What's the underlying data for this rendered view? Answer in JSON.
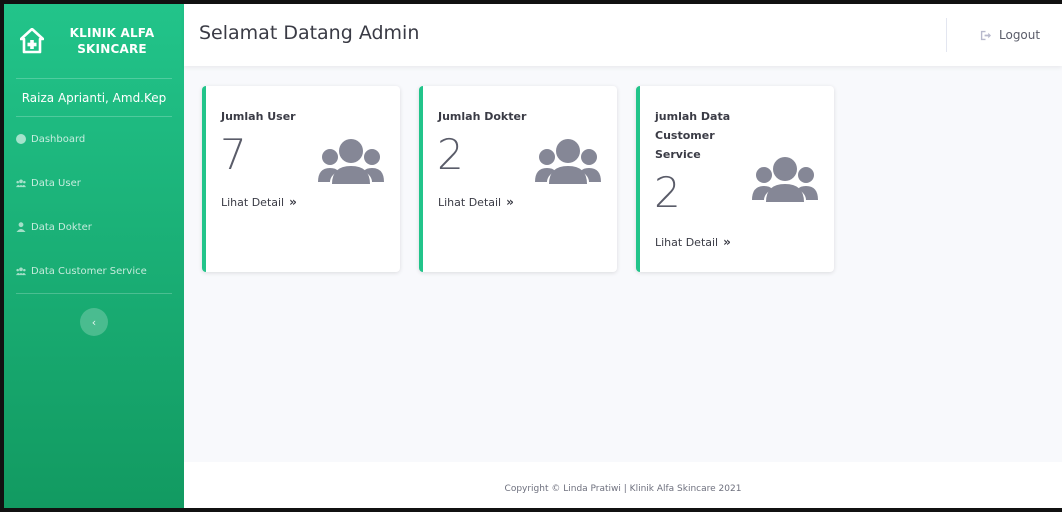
{
  "brand": {
    "line1": "KLINIK ALFA",
    "line2": "SKINCARE"
  },
  "sidebar": {
    "user_name": "Raiza Aprianti, Amd.Kep",
    "items": [
      {
        "label": "Dashboard",
        "icon": "palette-icon"
      },
      {
        "label": "Data User",
        "icon": "users-icon"
      },
      {
        "label": "Data Dokter",
        "icon": "user-doctor-icon"
      },
      {
        "label": "Data Customer Service",
        "icon": "users-icon"
      }
    ],
    "toggle_glyph": "‹"
  },
  "topbar": {
    "title": "Selamat Datang Admin",
    "logout_label": "Logout"
  },
  "cards": [
    {
      "title_line1": "Jumlah User",
      "title_line2": "",
      "title_line3": "",
      "value": "7",
      "link_label": "Lihat Detail",
      "link_glyph": "»"
    },
    {
      "title_line1": "Jumlah Dokter",
      "title_line2": "",
      "title_line3": "",
      "value": "2",
      "link_label": "Lihat Detail",
      "link_glyph": "»"
    },
    {
      "title_line1": "jumlah Data",
      "title_line2": "Customer",
      "title_line3": "Service",
      "value": "2",
      "link_label": "Lihat Detail",
      "link_glyph": "»"
    }
  ],
  "footer": {
    "text": "Copyright © Linda Pratiwi | Klinik Alfa Skincare 2021"
  },
  "colors": {
    "accent": "#22c48a",
    "sidebar_bottom": "#129a61",
    "icon_gray": "#858796"
  }
}
